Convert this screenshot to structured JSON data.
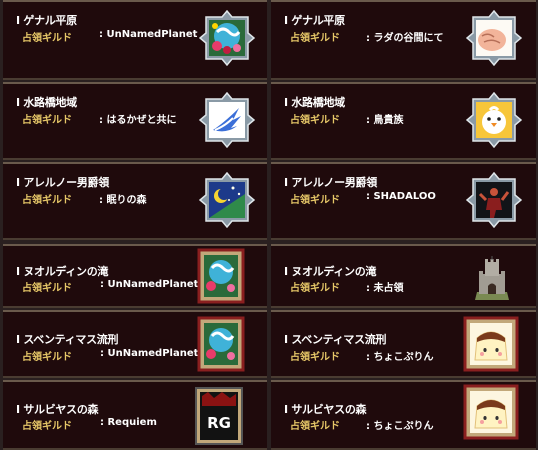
{
  "guild_label": "占領ギルド",
  "territories": [
    {
      "region": "I ゲナル平原",
      "guild": ": UnNamedPlanet",
      "emblem": "planet-flower-emblem-icon"
    },
    {
      "region": "I ゲナル平原",
      "guild": ": ラダの谷間にて",
      "emblem": "fist-emblem-icon"
    },
    {
      "region": "I 水路橋地域",
      "guild": ": はるかぜと共に",
      "emblem": "wing-emblem-icon"
    },
    {
      "region": "I 水路橋地域",
      "guild": ": 鳥貴族",
      "emblem": "chick-emblem-icon"
    },
    {
      "region": "I アレルノー男爵領",
      "guild": ": 眠りの森",
      "emblem": "moon-stars-emblem-icon"
    },
    {
      "region": "I アレルノー男爵領",
      "guild": ": SHADALOO",
      "emblem": "fighter-emblem-icon"
    },
    {
      "region": "I ヌオルディンの滝",
      "guild": ": UnNamedPlanet",
      "emblem": "planet-flower-emblem-icon"
    },
    {
      "region": "I ヌオルディンの滝",
      "guild": ": 未占領",
      "emblem": "castle-tower-icon"
    },
    {
      "region": "I スベンティマス流刑",
      "guild": ": UnNamedPlanet",
      "emblem": "planet-flower-emblem-icon"
    },
    {
      "region": "I スベンティマス流刑",
      "guild": ": ちょこぷりん",
      "emblem": "pudding-emblem-icon"
    },
    {
      "region": "I サルビヤスの森",
      "guild": ": Requiem",
      "emblem": "rg-logo-emblem-icon"
    },
    {
      "region": "I サルビヤスの森",
      "guild": ": ちょこぷりん",
      "emblem": "pudding-emblem-icon"
    }
  ],
  "colors": {
    "card_bg": "#1f0a0c",
    "label_gold": "#e7c868",
    "text_white": "#ffffff"
  }
}
